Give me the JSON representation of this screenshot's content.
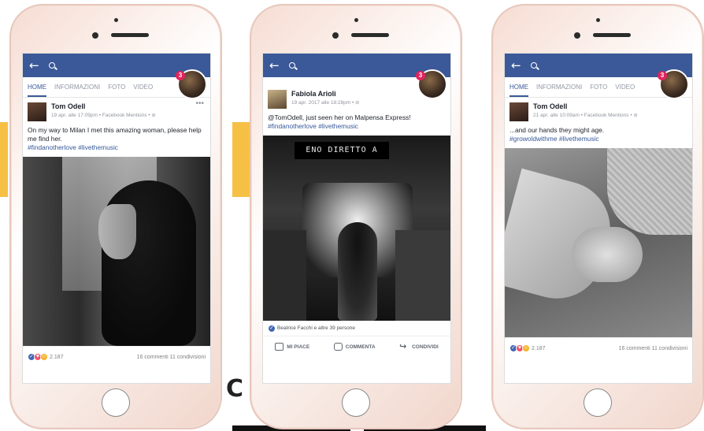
{
  "colors": {
    "facebook_blue": "#3b5998",
    "accent_yellow": "#f6c044",
    "notification_red": "#e0245e",
    "hashtag_blue": "#365899"
  },
  "phones": [
    {
      "notification_count": "3",
      "tabs": [
        "HOME",
        "INFORMAZIONI",
        "FOTO",
        "VIDEO"
      ],
      "active_tab": 0,
      "post": {
        "author": "Tom Odell",
        "meta": "19 apr. alle 17:09pm • Facebook Mentions • ⊘",
        "text": "On my way to Milan I met this amazing woman, please help me find her.",
        "hashtags": "#findanotherlove #livethemusic",
        "reaction_count": "2.187",
        "comments_shares": "16 commenti 11 condivisioni"
      }
    },
    {
      "notification_count": "3",
      "post": {
        "author": "Fabiola Arioli",
        "meta": "19 apr. 2017 alle 18:28pm • ⊘",
        "text": "@TomOdell, just seen her on Malpensa Express!",
        "hashtags": "#findanotherlove #livethemusic",
        "photo_sign": "ENO DIRETTO A",
        "liked_by": "Beatrice Facchi e altre 39 persone",
        "actions": [
          "MI PIACE",
          "COMMENTA",
          "CONDIVIDI"
        ]
      }
    },
    {
      "notification_count": "3",
      "tabs": [
        "HOME",
        "INFORMAZIONI",
        "FOTO",
        "VIDEO"
      ],
      "active_tab": 0,
      "post": {
        "author": "Tom Odell",
        "meta": "21 apr. alle 10:09am • Facebook Mentions • ⊘",
        "text": "...and our hands they might age.",
        "hashtags": "#growoldwithme #livethemusic",
        "reaction_count": "2.187",
        "comments_shares": "16 commenti 11 condivisioni"
      }
    }
  ],
  "decor": {
    "c_glyph": "C"
  }
}
